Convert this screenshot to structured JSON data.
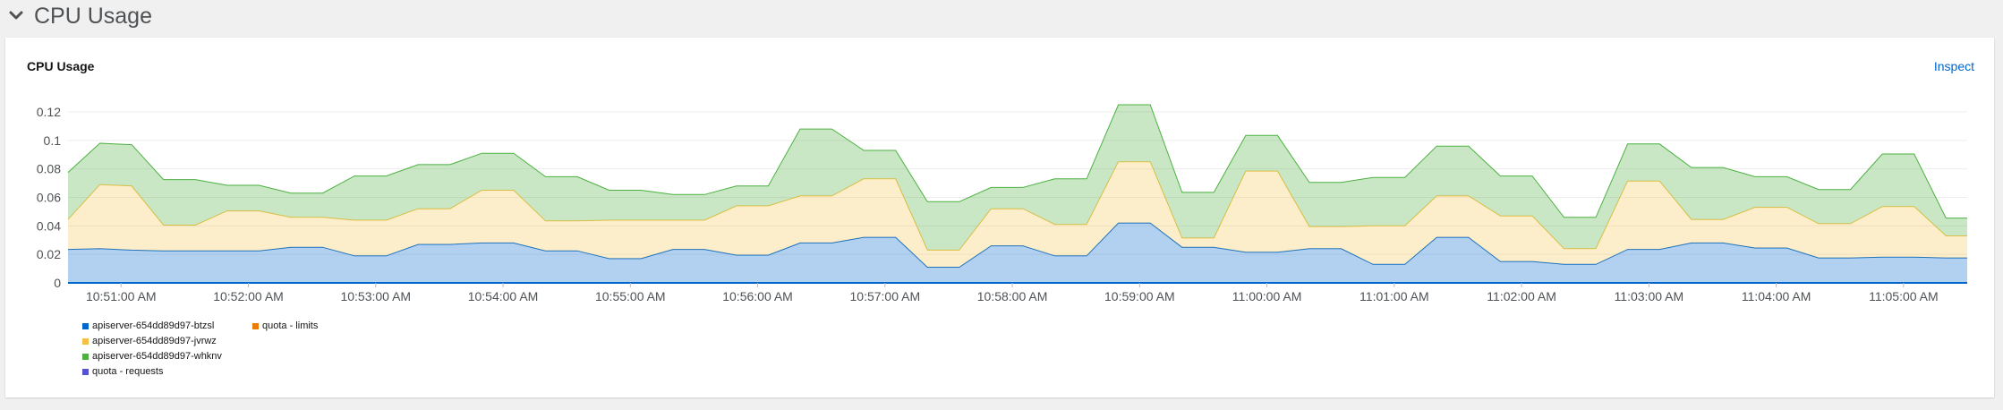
{
  "section": {
    "title": "CPU Usage"
  },
  "card": {
    "title": "CPU Usage",
    "inspect_label": "Inspect"
  },
  "legend": [
    {
      "label": "apiserver-654dd89d97-btzsl",
      "color": "#06c"
    },
    {
      "label": "quota - limits",
      "color": "#ec7a08"
    },
    {
      "label": "apiserver-654dd89d97-jvrwz",
      "color": "#f4c145"
    },
    {
      "label": "apiserver-654dd89d97-whknv",
      "color": "#4cb140"
    },
    {
      "label": "quota - requests",
      "color": "#5752d1"
    }
  ],
  "chart_data": {
    "type": "area",
    "stacked": true,
    "ylim": [
      0,
      0.12
    ],
    "y_ticks": [
      "0",
      "0.02",
      "0.04",
      "0.06",
      "0.08",
      "0.1",
      "0.12"
    ],
    "x_ticks": [
      "10:51:00 AM",
      "10:52:00 AM",
      "10:53:00 AM",
      "10:54:00 AM",
      "10:55:00 AM",
      "10:56:00 AM",
      "10:57:00 AM",
      "10:58:00 AM",
      "10:59:00 AM",
      "11:00:00 AM",
      "11:01:00 AM",
      "11:02:00 AM",
      "11:03:00 AM",
      "11:04:00 AM",
      "11:05:00 AM"
    ],
    "x_start": "10:50:35",
    "x_end": "11:05:30",
    "x": [
      "10:50:35",
      "10:50:50",
      "10:51:05",
      "10:51:20",
      "10:51:35",
      "10:51:50",
      "10:52:05",
      "10:52:20",
      "10:52:35",
      "10:52:50",
      "10:53:05",
      "10:53:20",
      "10:53:35",
      "10:53:50",
      "10:54:05",
      "10:54:20",
      "10:54:35",
      "10:54:50",
      "10:55:05",
      "10:55:20",
      "10:55:35",
      "10:55:50",
      "10:56:05",
      "10:56:20",
      "10:56:35",
      "10:56:50",
      "10:57:05",
      "10:57:20",
      "10:57:35",
      "10:57:50",
      "10:58:05",
      "10:58:20",
      "10:58:35",
      "10:58:50",
      "10:59:05",
      "10:59:20",
      "10:59:35",
      "10:59:50",
      "11:00:05",
      "11:00:20",
      "11:00:35",
      "11:00:50",
      "11:01:05",
      "11:01:20",
      "11:01:35",
      "11:01:50",
      "11:02:05",
      "11:02:20",
      "11:02:35",
      "11:02:50",
      "11:03:05",
      "11:03:20",
      "11:03:35",
      "11:03:50",
      "11:04:05",
      "11:04:20",
      "11:04:35",
      "11:04:50",
      "11:05:05",
      "11:05:20",
      "11:05:30"
    ],
    "series": [
      {
        "name": "apiserver-654dd89d97-btzsl",
        "color": "#06c",
        "values": [
          0.0235,
          0.024,
          0.023,
          0.0225,
          0.0225,
          0.0225,
          0.0225,
          0.025,
          0.025,
          0.019,
          0.019,
          0.027,
          0.027,
          0.028,
          0.028,
          0.0225,
          0.0225,
          0.017,
          0.017,
          0.0235,
          0.0235,
          0.0195,
          0.0195,
          0.028,
          0.028,
          0.032,
          0.032,
          0.011,
          0.011,
          0.026,
          0.026,
          0.019,
          0.019,
          0.042,
          0.042,
          0.025,
          0.025,
          0.0215,
          0.0215,
          0.024,
          0.024,
          0.013,
          0.013,
          0.032,
          0.032,
          0.015,
          0.015,
          0.013,
          0.013,
          0.0235,
          0.0235,
          0.028,
          0.028,
          0.0245,
          0.0245,
          0.0175,
          0.0175,
          0.018,
          0.018,
          0.0175,
          0.0175
        ]
      },
      {
        "name": "apiserver-654dd89d97-jvrwz",
        "color": "#f4c145",
        "values": [
          0.021,
          0.045,
          0.045,
          0.018,
          0.018,
          0.028,
          0.028,
          0.021,
          0.021,
          0.025,
          0.025,
          0.025,
          0.025,
          0.037,
          0.037,
          0.021,
          0.021,
          0.027,
          0.027,
          0.0205,
          0.0205,
          0.0345,
          0.0345,
          0.033,
          0.033,
          0.041,
          0.041,
          0.012,
          0.012,
          0.026,
          0.026,
          0.022,
          0.022,
          0.043,
          0.043,
          0.0065,
          0.0065,
          0.057,
          0.057,
          0.0155,
          0.0155,
          0.027,
          0.027,
          0.029,
          0.029,
          0.032,
          0.032,
          0.011,
          0.011,
          0.048,
          0.048,
          0.0165,
          0.0165,
          0.0285,
          0.0285,
          0.024,
          0.024,
          0.0355,
          0.0355,
          0.0155,
          0.0155
        ]
      },
      {
        "name": "apiserver-654dd89d97-whknv",
        "color": "#4cb140",
        "values": [
          0.033,
          0.029,
          0.029,
          0.032,
          0.032,
          0.018,
          0.018,
          0.017,
          0.017,
          0.031,
          0.031,
          0.031,
          0.031,
          0.026,
          0.026,
          0.031,
          0.031,
          0.021,
          0.021,
          0.018,
          0.018,
          0.014,
          0.014,
          0.047,
          0.047,
          0.02,
          0.02,
          0.034,
          0.034,
          0.015,
          0.015,
          0.032,
          0.032,
          0.04,
          0.04,
          0.032,
          0.032,
          0.025,
          0.025,
          0.031,
          0.031,
          0.034,
          0.034,
          0.035,
          0.035,
          0.028,
          0.028,
          0.022,
          0.022,
          0.026,
          0.026,
          0.0365,
          0.0365,
          0.0215,
          0.0215,
          0.024,
          0.024,
          0.037,
          0.037,
          0.0125,
          0.0125
        ]
      }
    ],
    "grid": true,
    "legend_position": "bottom-left"
  }
}
